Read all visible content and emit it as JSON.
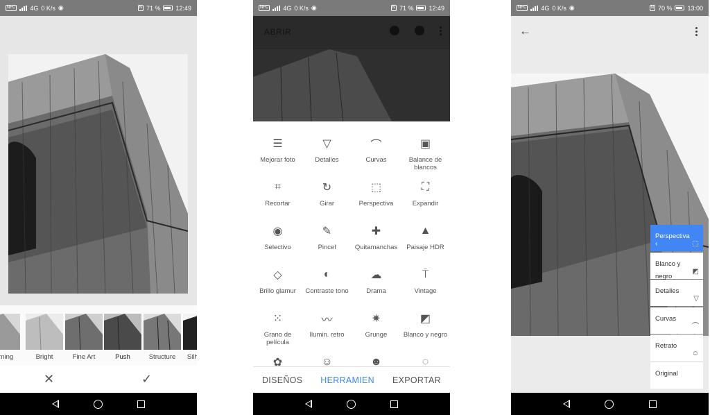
{
  "phone1": {
    "status": {
      "network": "4G",
      "speed": "0 K/s",
      "battery": "71 %",
      "time": "12:49"
    },
    "filters": [
      {
        "label": "Morning"
      },
      {
        "label": "Bright"
      },
      {
        "label": "Fine Art"
      },
      {
        "label": "Push"
      },
      {
        "label": "Structure"
      },
      {
        "label": "Silhouette"
      }
    ],
    "cancel_icon": "close-icon",
    "confirm_icon": "check-icon"
  },
  "phone2": {
    "status": {
      "network": "4G",
      "speed": "0 K/s",
      "battery": "71 %",
      "time": "12:49"
    },
    "header": {
      "open_label": "ABRIR"
    },
    "tools": [
      {
        "label": "Mejorar foto",
        "icon": "tune-icon"
      },
      {
        "label": "Detalles",
        "icon": "triangle-down-icon"
      },
      {
        "label": "Curvas",
        "icon": "curves-icon"
      },
      {
        "label": "Balance de blancos",
        "icon": "white-balance-icon"
      },
      {
        "label": "Recortar",
        "icon": "crop-icon"
      },
      {
        "label": "Girar",
        "icon": "rotate-icon"
      },
      {
        "label": "Perspectiva",
        "icon": "perspective-icon"
      },
      {
        "label": "Expandir",
        "icon": "expand-icon"
      },
      {
        "label": "Selectivo",
        "icon": "target-icon"
      },
      {
        "label": "Pincel",
        "icon": "brush-icon"
      },
      {
        "label": "Quitamanchas",
        "icon": "healing-icon"
      },
      {
        "label": "Paisaje HDR",
        "icon": "mountain-icon"
      },
      {
        "label": "Brillo glamur",
        "icon": "diamond-icon"
      },
      {
        "label": "Contraste tono",
        "icon": "contrast-icon"
      },
      {
        "label": "Drama",
        "icon": "cloud-icon"
      },
      {
        "label": "Vintage",
        "icon": "lamp-icon"
      },
      {
        "label": "Grano de película",
        "icon": "grain-icon"
      },
      {
        "label": "Ilumin. retro",
        "icon": "mustache-icon"
      },
      {
        "label": "Grunge",
        "icon": "grunge-icon"
      },
      {
        "label": "Blanco y negro",
        "icon": "bw-icon"
      },
      {
        "label": "",
        "icon": "film-reel-icon"
      },
      {
        "label": "",
        "icon": "face-icon"
      },
      {
        "label": "",
        "icon": "face-frame-icon"
      },
      {
        "label": "",
        "icon": "dots-circle-icon"
      }
    ],
    "tabs": [
      {
        "label": "DISEÑOS"
      },
      {
        "label": "HERRAMIEN"
      },
      {
        "label": "EXPORTAR"
      }
    ],
    "active_tab": 1,
    "accent": "#4285f4"
  },
  "phone3": {
    "status": {
      "network": "4G",
      "speed": "0 K/s",
      "battery": "70 %",
      "time": "13:00"
    },
    "stack": [
      {
        "label": "Perspectiva",
        "icon": "perspective-icon",
        "active": true
      },
      {
        "label": "Blanco y negro",
        "icon": "bw-icon",
        "active": false
      },
      {
        "label": "Detalles",
        "icon": "triangle-down-icon",
        "active": false
      },
      {
        "label": "Curvas",
        "icon": "curves-icon",
        "active": false
      },
      {
        "label": "Retrato",
        "icon": "face-icon",
        "active": false
      },
      {
        "label": "Original",
        "icon": "",
        "active": false
      }
    ]
  }
}
